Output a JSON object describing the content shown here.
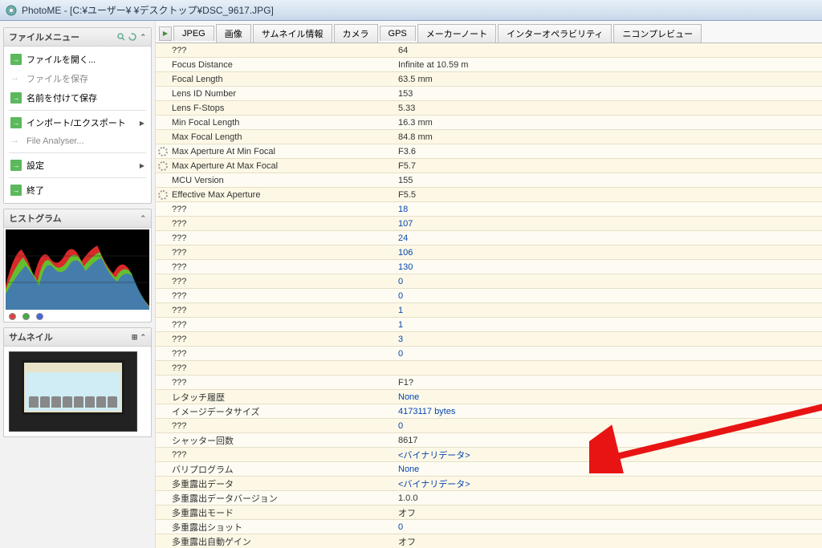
{
  "window": {
    "title": "PhotoME - [C:¥ユーザー¥      ¥デスクトップ¥DSC_9617.JPG]"
  },
  "sidebar": {
    "fileMenu": {
      "title": "ファイルメニュー",
      "items": {
        "open": "ファイルを開く...",
        "save": "ファイルを保存",
        "saveAs": "名前を付けて保存",
        "importExport": "インポート/エクスポート",
        "fileAnalyser": "File Analyser...",
        "settings": "設定",
        "exit": "終了"
      }
    },
    "histogram": {
      "title": "ヒストグラム"
    },
    "thumbnail": {
      "title": "サムネイル"
    }
  },
  "tabs": [
    "JPEG",
    "画像",
    "サムネイル情報",
    "カメラ",
    "GPS",
    "メーカーノート",
    "インターオペラビリティ",
    "ニコンプレビュー"
  ],
  "rows": [
    {
      "n": "???",
      "v": "64"
    },
    {
      "n": "Focus Distance",
      "v": "Infinite at 10.59 m"
    },
    {
      "n": "Focal Length",
      "v": "63.5 mm"
    },
    {
      "n": "Lens ID Number",
      "v": "153"
    },
    {
      "n": "Lens F-Stops",
      "v": "5.33"
    },
    {
      "n": "Min Focal Length",
      "v": "16.3 mm"
    },
    {
      "n": "Max Focal Length",
      "v": "84.8 mm"
    },
    {
      "n": "Max Aperture At Min Focal",
      "v": "F3.6",
      "icon": true
    },
    {
      "n": "Max Aperture At Max Focal",
      "v": "F5.7",
      "icon": true
    },
    {
      "n": "MCU Version",
      "v": "155"
    },
    {
      "n": "Effective Max Aperture",
      "v": "F5.5",
      "icon": true
    },
    {
      "n": "???",
      "v": "18",
      "link": true
    },
    {
      "n": "???",
      "v": "107",
      "link": true
    },
    {
      "n": "???",
      "v": "24",
      "link": true
    },
    {
      "n": "???",
      "v": "106",
      "link": true
    },
    {
      "n": "???",
      "v": "130",
      "link": true
    },
    {
      "n": "???",
      "v": "0",
      "link": true
    },
    {
      "n": "???",
      "v": "0",
      "link": true
    },
    {
      "n": "???",
      "v": "1",
      "link": true
    },
    {
      "n": "???",
      "v": "1",
      "link": true
    },
    {
      "n": "???",
      "v": "3",
      "link": true
    },
    {
      "n": "???",
      "v": "0",
      "link": true
    },
    {
      "n": "???",
      "v": "",
      "link": false
    },
    {
      "n": "???",
      "v": "F1?",
      "link": false
    },
    {
      "n": "レタッチ履歴",
      "v": "None",
      "link": true
    },
    {
      "n": "イメージデータサイズ",
      "v": "4173117 bytes",
      "link": true
    },
    {
      "n": "???",
      "v": "0",
      "link": true
    },
    {
      "n": "シャッター回数",
      "v": "8617"
    },
    {
      "n": "???",
      "v": "<バイナリデータ>",
      "link": true
    },
    {
      "n": "バリプログラム",
      "v": "None",
      "link": true
    },
    {
      "n": "多重露出データ",
      "v": "<バイナリデータ>",
      "link": true
    },
    {
      "n": "多重露出データバージョン",
      "v": "1.0.0"
    },
    {
      "n": "多重露出モード",
      "v": "オフ"
    },
    {
      "n": "多重露出ショット",
      "v": "0",
      "link": true
    },
    {
      "n": "多重露出自動ゲイン",
      "v": "オフ"
    }
  ]
}
